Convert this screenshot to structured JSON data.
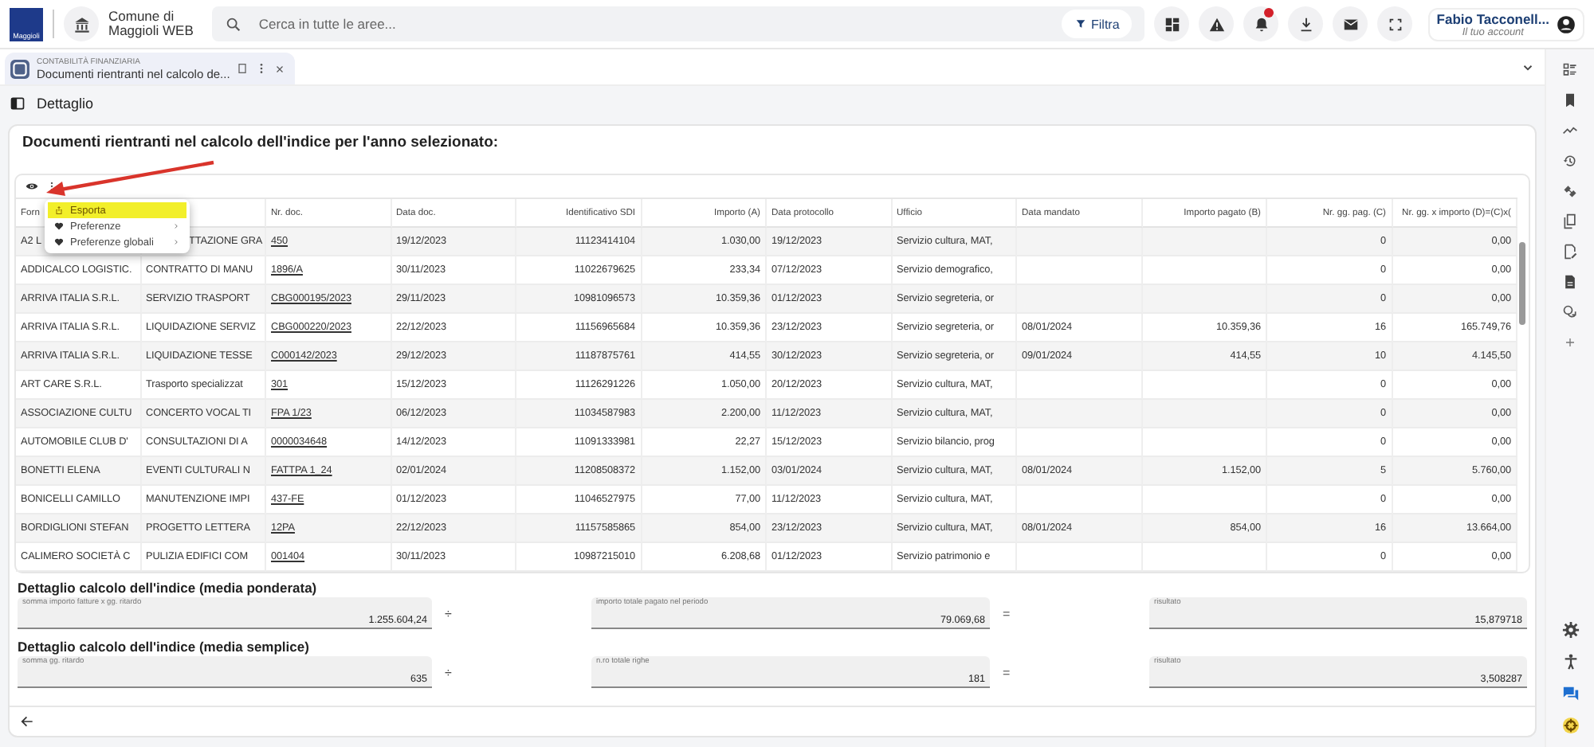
{
  "header": {
    "logo_text": "Maggioli",
    "org": [
      "Comune di",
      "Maggioli WEB"
    ],
    "search": {
      "placeholder": "Cerca in tutte le aree..."
    },
    "filter_button": "Filtra",
    "user": {
      "name": "Fabio Tacconell...",
      "subtitle": "Il tuo account"
    }
  },
  "tab": {
    "section": "CONTABILITÀ FINANZIARIA",
    "title": "Documenti rientranti nel calcolo de...",
    "selected": true
  },
  "panel_title": "Dettaglio",
  "card_title": "Documenti rientranti nel calcolo dell'indice per l'anno selezionato:",
  "menu": [
    {
      "label": "Esporta",
      "kind": "action",
      "selected": true
    },
    {
      "label": "Preferenze",
      "kind": "submenu",
      "selected": false
    },
    {
      "label": "Preferenze globali",
      "kind": "submenu",
      "selected": false
    }
  ],
  "table": {
    "columns": [
      {
        "label": "Forn",
        "kind": "text"
      },
      {
        "kind": "text"
      },
      {
        "label": "Nr. doc.",
        "kind": "link"
      },
      {
        "label": "Data doc.",
        "kind": "text"
      },
      {
        "label": "Identificativo SDI",
        "kind": "number"
      },
      {
        "label": "Importo (A)",
        "kind": "number"
      },
      {
        "label": "Data protocollo",
        "kind": "text"
      },
      {
        "label": "Ufficio",
        "kind": "text"
      },
      {
        "label": "Data mandato",
        "kind": "text"
      },
      {
        "label": "Importo pagato (B)",
        "kind": "number"
      },
      {
        "label": "Nr. gg. pag. (C)",
        "kind": "number"
      },
      {
        "label": "Nr. gg. x importo (D)=(C)x(",
        "kind": "number"
      }
    ],
    "rows": [
      [
        "A2 L",
        "TTAZIONE GRA",
        "450",
        "19/12/2023",
        "11123414104",
        "1.030,00",
        "19/12/2023",
        "Servizio cultura, MAT,",
        null,
        null,
        "0",
        "0,00"
      ],
      [
        "ADDICALCO LOGISTIC.",
        "CONTRATTO DI MANU",
        "1896/A",
        "30/11/2023",
        "11022679625",
        "233,34",
        "07/12/2023",
        "Servizio demografico,",
        null,
        null,
        "0",
        "0,00"
      ],
      [
        "ARRIVA ITALIA S.R.L.",
        "SERVIZIO TRASPORT",
        "CBG000195/2023",
        "29/11/2023",
        "10981096573",
        "10.359,36",
        "01/12/2023",
        "Servizio segreteria, or",
        null,
        null,
        "0",
        "0,00"
      ],
      [
        "ARRIVA ITALIA S.R.L.",
        "LIQUIDAZIONE SERVIZ",
        "CBG000220/2023",
        "22/12/2023",
        "11156965684",
        "10.359,36",
        "23/12/2023",
        "Servizio segreteria, or",
        "08/01/2024",
        "10.359,36",
        "16",
        "165.749,76"
      ],
      [
        "ARRIVA ITALIA S.R.L.",
        "LIQUIDAZIONE TESSE",
        "C000142/2023",
        "29/12/2023",
        "11187875761",
        "414,55",
        "30/12/2023",
        "Servizio segreteria, or",
        "09/01/2024",
        "414,55",
        "10",
        "4.145,50"
      ],
      [
        "ART CARE S.R.L.",
        "Trasporto specializzat",
        "301",
        "15/12/2023",
        "11126291226",
        "1.050,00",
        "20/12/2023",
        "Servizio cultura, MAT,",
        null,
        null,
        "0",
        "0,00"
      ],
      [
        "ASSOCIAZIONE CULTU",
        "CONCERTO VOCAL TI",
        "FPA 1/23",
        "06/12/2023",
        "11034587983",
        "2.200,00",
        "11/12/2023",
        "Servizio cultura, MAT,",
        null,
        null,
        "0",
        "0,00"
      ],
      [
        "AUTOMOBILE CLUB D'",
        "CONSULTAZIONI DI A",
        "0000034648",
        "14/12/2023",
        "11091333981",
        "22,27",
        "15/12/2023",
        "Servizio bilancio, prog",
        null,
        null,
        "0",
        "0,00"
      ],
      [
        "BONETTI ELENA",
        "EVENTI CULTURALI N",
        "FATTPA 1_24",
        "02/01/2024",
        "11208508372",
        "1.152,00",
        "03/01/2024",
        "Servizio cultura, MAT,",
        "08/01/2024",
        "1.152,00",
        "5",
        "5.760,00"
      ],
      [
        "BONICELLI CAMILLO",
        "MANUTENZIONE IMPI",
        "437-FE",
        "01/12/2023",
        "11046527975",
        "77,00",
        "11/12/2023",
        "Servizio cultura, MAT,",
        null,
        null,
        "0",
        "0,00"
      ],
      [
        "BORDIGLIONI STEFAN",
        "PROGETTO LETTERA",
        "12PA",
        "22/12/2023",
        "11157585865",
        "854,00",
        "23/12/2023",
        "Servizio cultura, MAT,",
        "08/01/2024",
        "854,00",
        "16",
        "13.664,00"
      ],
      [
        "CALIMERO SOCIETÀ C",
        "PULIZIA EDIFICI COM",
        "001404",
        "30/11/2023",
        "10987215010",
        "6.208,68",
        "01/12/2023",
        "Servizio patrimonio e",
        null,
        null,
        "0",
        "0,00"
      ]
    ]
  },
  "calculations": [
    {
      "title": "Dettaglio calcolo dell'indice (media ponderata)",
      "numerator": {
        "label": "somma importo fatture x gg. ritardo",
        "value": "1.255.604,24"
      },
      "operator": "÷",
      "denominator": {
        "label": "importo totale pagato nel periodo",
        "value": "79.069,68"
      },
      "equals": "=",
      "result": {
        "label": "risultato",
        "value": "15,879718"
      }
    },
    {
      "title": "Dettaglio calcolo dell'indice (media semplice)",
      "numerator": {
        "label": "somma gg. ritardo",
        "value": "635"
      },
      "operator": "÷",
      "denominator": {
        "label": "n.ro totale righe",
        "value": "181"
      },
      "equals": "=",
      "result": {
        "label": "risultato",
        "value": "3,508287"
      }
    }
  ]
}
